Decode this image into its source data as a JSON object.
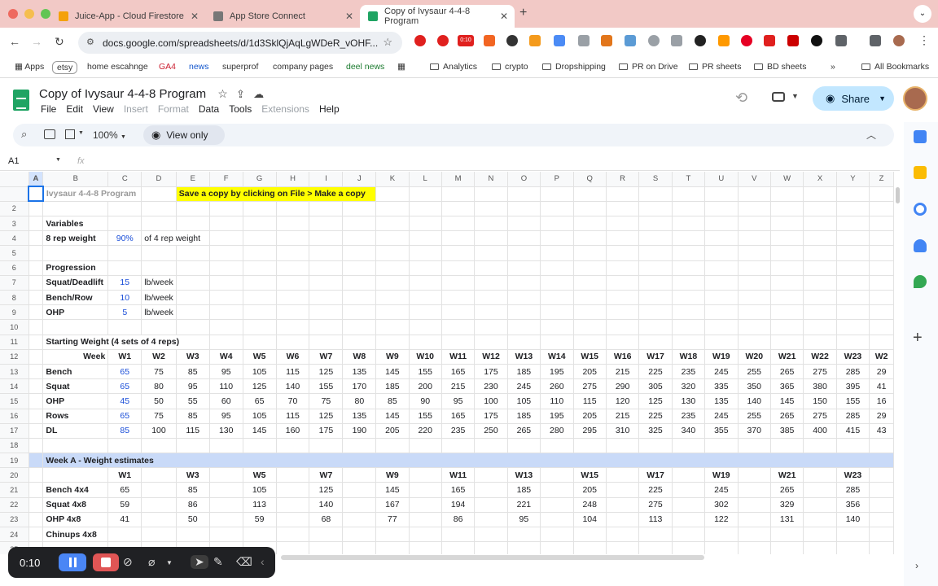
{
  "browser": {
    "tabs": [
      {
        "label": "Juice-App - Cloud Firestore",
        "color": "#f4a10b"
      },
      {
        "label": "App Store Connect",
        "color": "#777777"
      },
      {
        "label": "Copy of Ivysaur 4-4-8 Program",
        "color": "#1fa463"
      }
    ],
    "url": "docs.google.com/spreadsheets/d/1d3SklQjAqLgWDeR_vOHF...",
    "bookmarks": [
      "Apps",
      "etsy",
      "home escahnge",
      "GA4",
      "news",
      "superprof",
      "company pages",
      "deel news",
      "Analytics",
      "crypto",
      "Dropshipping",
      "PR on Drive",
      "PR sheets",
      "BD sheets",
      "All Bookmarks"
    ],
    "ext_badge": "0:10"
  },
  "doc": {
    "title": "Copy of Ivysaur 4-4-8 Program",
    "menus": [
      {
        "label": "File",
        "disabled": false
      },
      {
        "label": "Edit",
        "disabled": false
      },
      {
        "label": "View",
        "disabled": false
      },
      {
        "label": "Insert",
        "disabled": true
      },
      {
        "label": "Format",
        "disabled": true
      },
      {
        "label": "Data",
        "disabled": false
      },
      {
        "label": "Tools",
        "disabled": false
      },
      {
        "label": "Extensions",
        "disabled": true
      },
      {
        "label": "Help",
        "disabled": false
      }
    ],
    "share_label": "Share",
    "zoom": "100%",
    "view_only_label": "View only",
    "cell_ref": "A1",
    "fx": "fx"
  },
  "sheet": {
    "columns": [
      "A",
      "B",
      "C",
      "D",
      "E",
      "F",
      "G",
      "H",
      "I",
      "J",
      "K",
      "L",
      "M",
      "N",
      "O",
      "P",
      "Q",
      "R",
      "S",
      "T",
      "U",
      "V",
      "W",
      "X",
      "Y",
      "Z"
    ],
    "col_widths": [
      18,
      80,
      41,
      41,
      41,
      41,
      41,
      41,
      41,
      41,
      41,
      41,
      41,
      41,
      41,
      41,
      41,
      41,
      41,
      41,
      41,
      41,
      41,
      41,
      41,
      30
    ],
    "header_cut": "Ivysaur 4-4-8 Program",
    "header_note": "Save a copy by clicking on File > Make a copy",
    "rows": [
      {
        "n": "2",
        "cells": []
      },
      {
        "n": "3",
        "cells": [
          {
            "c": 1,
            "v": "Variables",
            "cls": "b"
          }
        ]
      },
      {
        "n": "4",
        "cells": [
          {
            "c": 1,
            "v": "8 rep weight",
            "cls": "b"
          },
          {
            "c": 2,
            "v": "90%",
            "cls": "c blue"
          },
          {
            "c": 3,
            "v": "of 4 rep weight",
            "cls": "",
            "span": 2
          }
        ]
      },
      {
        "n": "5",
        "cells": []
      },
      {
        "n": "6",
        "cells": [
          {
            "c": 1,
            "v": "Progression",
            "cls": "b"
          }
        ]
      },
      {
        "n": "7",
        "cells": [
          {
            "c": 1,
            "v": "Squat/Deadlift",
            "cls": "b"
          },
          {
            "c": 2,
            "v": "15",
            "cls": "c blue"
          },
          {
            "c": 3,
            "v": "lb/week",
            "cls": ""
          }
        ]
      },
      {
        "n": "8",
        "cells": [
          {
            "c": 1,
            "v": "Bench/Row",
            "cls": "b"
          },
          {
            "c": 2,
            "v": "10",
            "cls": "c blue"
          },
          {
            "c": 3,
            "v": "lb/week",
            "cls": ""
          }
        ]
      },
      {
        "n": "9",
        "cells": [
          {
            "c": 1,
            "v": "OHP",
            "cls": "b"
          },
          {
            "c": 2,
            "v": "5",
            "cls": "c blue"
          },
          {
            "c": 3,
            "v": "lb/week",
            "cls": ""
          }
        ]
      },
      {
        "n": "10",
        "cells": []
      },
      {
        "n": "11",
        "cells": [
          {
            "c": 1,
            "v": "Starting Weight (4 sets of 4 reps)",
            "cls": "b",
            "span": 4
          }
        ]
      },
      {
        "n": "12",
        "type": "weeks",
        "label": "Week",
        "vals": [
          "W1",
          "W2",
          "W3",
          "W4",
          "W5",
          "W6",
          "W7",
          "W8",
          "W9",
          "W10",
          "W11",
          "W12",
          "W13",
          "W14",
          "W15",
          "W16",
          "W17",
          "W18",
          "W19",
          "W20",
          "W21",
          "W22",
          "W23",
          "W2"
        ]
      },
      {
        "n": "13",
        "type": "lift",
        "label": "Bench",
        "vals": [
          "65",
          "75",
          "85",
          "95",
          "105",
          "115",
          "125",
          "135",
          "145",
          "155",
          "165",
          "175",
          "185",
          "195",
          "205",
          "215",
          "225",
          "235",
          "245",
          "255",
          "265",
          "275",
          "285",
          "29"
        ]
      },
      {
        "n": "14",
        "type": "lift",
        "label": "Squat",
        "vals": [
          "65",
          "80",
          "95",
          "110",
          "125",
          "140",
          "155",
          "170",
          "185",
          "200",
          "215",
          "230",
          "245",
          "260",
          "275",
          "290",
          "305",
          "320",
          "335",
          "350",
          "365",
          "380",
          "395",
          "41"
        ]
      },
      {
        "n": "15",
        "type": "lift",
        "label": "OHP",
        "vals": [
          "45",
          "50",
          "55",
          "60",
          "65",
          "70",
          "75",
          "80",
          "85",
          "90",
          "95",
          "100",
          "105",
          "110",
          "115",
          "120",
          "125",
          "130",
          "135",
          "140",
          "145",
          "150",
          "155",
          "16"
        ]
      },
      {
        "n": "16",
        "type": "lift",
        "label": "Rows",
        "vals": [
          "65",
          "75",
          "85",
          "95",
          "105",
          "115",
          "125",
          "135",
          "145",
          "155",
          "165",
          "175",
          "185",
          "195",
          "205",
          "215",
          "225",
          "235",
          "245",
          "255",
          "265",
          "275",
          "285",
          "29"
        ]
      },
      {
        "n": "17",
        "type": "lift",
        "label": "DL",
        "vals": [
          "85",
          "100",
          "115",
          "130",
          "145",
          "160",
          "175",
          "190",
          "205",
          "220",
          "235",
          "250",
          "265",
          "280",
          "295",
          "310",
          "325",
          "340",
          "355",
          "370",
          "385",
          "400",
          "415",
          "43"
        ]
      },
      {
        "n": "18",
        "cells": []
      },
      {
        "n": "19",
        "type": "weekA",
        "label": "Week A - Weight estimates"
      },
      {
        "n": "20",
        "type": "est",
        "label": "",
        "bold": true,
        "vals": [
          "W1",
          "",
          "W3",
          "",
          "W5",
          "",
          "W7",
          "",
          "W9",
          "",
          "W11",
          "",
          "W13",
          "",
          "W15",
          "",
          "W17",
          "",
          "W19",
          "",
          "W21",
          "",
          "W23",
          ""
        ]
      },
      {
        "n": "21",
        "type": "est",
        "label": "Bench 4x4",
        "vals": [
          "65",
          "",
          "85",
          "",
          "105",
          "",
          "125",
          "",
          "145",
          "",
          "165",
          "",
          "185",
          "",
          "205",
          "",
          "225",
          "",
          "245",
          "",
          "265",
          "",
          "285",
          ""
        ]
      },
      {
        "n": "22",
        "type": "est",
        "label": "Squat 4x8",
        "vals": [
          "59",
          "",
          "86",
          "",
          "113",
          "",
          "140",
          "",
          "167",
          "",
          "194",
          "",
          "221",
          "",
          "248",
          "",
          "275",
          "",
          "302",
          "",
          "329",
          "",
          "356",
          ""
        ]
      },
      {
        "n": "23",
        "type": "est",
        "label": "OHP 4x8",
        "vals": [
          "41",
          "",
          "50",
          "",
          "59",
          "",
          "68",
          "",
          "77",
          "",
          "86",
          "",
          "95",
          "",
          "104",
          "",
          "113",
          "",
          "122",
          "",
          "131",
          "",
          "140",
          ""
        ]
      },
      {
        "n": "24",
        "type": "est",
        "label": "Chinups 4x8",
        "vals": []
      },
      {
        "n": "25",
        "cells": []
      }
    ]
  },
  "recorder": {
    "time": "0:10"
  }
}
